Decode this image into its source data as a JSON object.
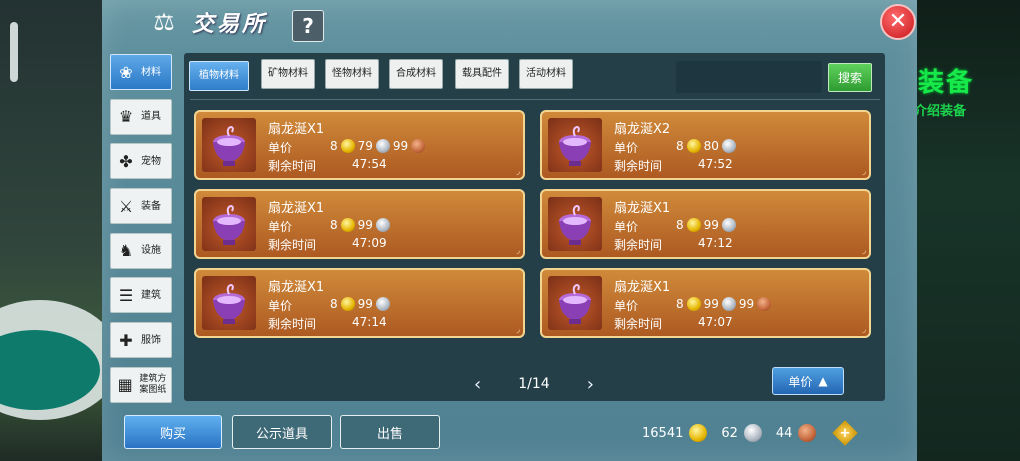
{
  "header": {
    "title": "交易所",
    "help_label": "?",
    "close_label": "✕"
  },
  "sidebar": {
    "items": [
      {
        "label": "材料",
        "icon": "cluster-icon",
        "glyph": "❀",
        "active": true
      },
      {
        "label": "道具",
        "icon": "flask-icon",
        "glyph": "♛",
        "active": false
      },
      {
        "label": "宠物",
        "icon": "paw-icon",
        "glyph": "✤",
        "active": false
      },
      {
        "label": "装备",
        "icon": "sword-icon",
        "glyph": "⚔",
        "active": false
      },
      {
        "label": "设施",
        "icon": "horse-icon",
        "glyph": "♞",
        "active": false
      },
      {
        "label": "建筑",
        "icon": "building-icon",
        "glyph": "☰",
        "active": false
      },
      {
        "label": "服饰",
        "icon": "clothing-icon",
        "glyph": "✚",
        "active": false
      },
      {
        "label": "建筑方案图纸",
        "icon": "blueprint-icon",
        "glyph": "▦",
        "active": false
      }
    ]
  },
  "tabs": [
    "植物材料",
    "矿物材料",
    "怪物材料",
    "合成材料",
    "载具配件",
    "活动材料"
  ],
  "search": {
    "placeholder": "",
    "button_label": "搜索"
  },
  "listings": [
    {
      "name": "扇龙涎X1",
      "unit_label": "单价",
      "qty": "8",
      "gold": "79",
      "silver": "99",
      "copper": "",
      "time_label": "剩余时间",
      "time": "47:54"
    },
    {
      "name": "扇龙涎X2",
      "unit_label": "单价",
      "qty": "8",
      "gold": "80",
      "silver": "",
      "copper": "",
      "time_label": "剩余时间",
      "time": "47:52"
    },
    {
      "name": "扇龙涎X1",
      "unit_label": "单价",
      "qty": "8",
      "gold": "99",
      "silver": "",
      "copper": "",
      "time_label": "剩余时间",
      "time": "47:09"
    },
    {
      "name": "扇龙涎X1",
      "unit_label": "单价",
      "qty": "8",
      "gold": "99",
      "silver": "",
      "copper": "",
      "time_label": "剩余时间",
      "time": "47:12"
    },
    {
      "name": "扇龙涎X1",
      "unit_label": "单价",
      "qty": "8",
      "gold": "99",
      "silver": "",
      "copper": "",
      "time_label": "剩余时间",
      "time": "47:14"
    },
    {
      "name": "扇龙涎X1",
      "unit_label": "单价",
      "qty": "8",
      "gold": "99",
      "silver": "99",
      "copper": "",
      "time_label": "剩余时间",
      "time": "47:07"
    }
  ],
  "pagination": {
    "page": "1/14",
    "prev": "‹",
    "next": "›"
  },
  "sort": {
    "label": "单价"
  },
  "actions": {
    "buy": "购买",
    "public": "公示道具",
    "sell": "出售"
  },
  "wallet": {
    "gold": "16541",
    "silver": "62",
    "copper": "44"
  },
  "background": {
    "banner": "装备",
    "banner_sub": "介绍装备"
  },
  "colors": {
    "accent": "#2f7cc9",
    "card": "#c07432",
    "search": "#3fb540",
    "close": "#d21d22"
  }
}
